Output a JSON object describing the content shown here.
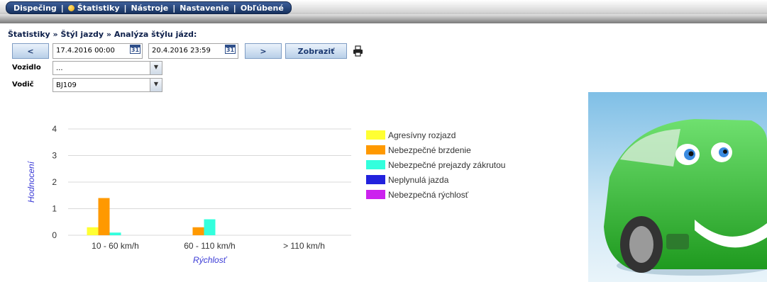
{
  "nav": {
    "items": [
      "Dispečing",
      "Štatistiky",
      "Nástroje",
      "Nastavenie",
      "Obľúbené"
    ],
    "separator": "|"
  },
  "breadcrumb": "Štatistiky » Štýl jazdy » Analýza štýlu jázd:",
  "toolbar": {
    "prev_label": "<",
    "from": "17.4.2016 00:00",
    "to": "20.4.2016 23:59",
    "calendar_day": "31",
    "next_label": ">",
    "show_label": "Zobraziť"
  },
  "filters": {
    "vehicle_label": "Vozidlo",
    "vehicle_value": "...",
    "driver_label": "Vodič",
    "driver_value": "BJ109"
  },
  "colors": {
    "nav_bg": "#1f3c6e",
    "button_bg": "#c9dbef",
    "axis_label": "#3b3bd6",
    "car": "#3cc43c"
  },
  "icons": [
    "print-icon",
    "calendar-icon",
    "dropdown-arrow-icon",
    "status-dot-icon"
  ],
  "chart_data": {
    "type": "bar",
    "categories": [
      "10 - 60 km/h",
      "60 - 110 km/h",
      "> 110 km/h"
    ],
    "xlabel": "Rýchlosť",
    "ylabel": "Hodnocení",
    "ylim": [
      0,
      4
    ],
    "yticks": [
      0,
      1,
      2,
      3,
      4
    ],
    "grid": true,
    "legend_position": "right",
    "series": [
      {
        "name": "Agresívny rozjazd",
        "color": "#ffff33",
        "values": [
          0.3,
          0,
          0
        ]
      },
      {
        "name": "Nebezpečné brzdenie",
        "color": "#ff9900",
        "values": [
          1.4,
          0.3,
          0
        ]
      },
      {
        "name": "Nebezpečné prejazdy zákrutou",
        "color": "#33ffdd",
        "values": [
          0.1,
          0.6,
          0
        ]
      },
      {
        "name": "Neplynulá jazda",
        "color": "#2222dd",
        "values": [
          0,
          0,
          0
        ]
      },
      {
        "name": "Nebezpečná rýchlosť",
        "color": "#cc22ee",
        "values": [
          0,
          0,
          0
        ]
      }
    ]
  }
}
